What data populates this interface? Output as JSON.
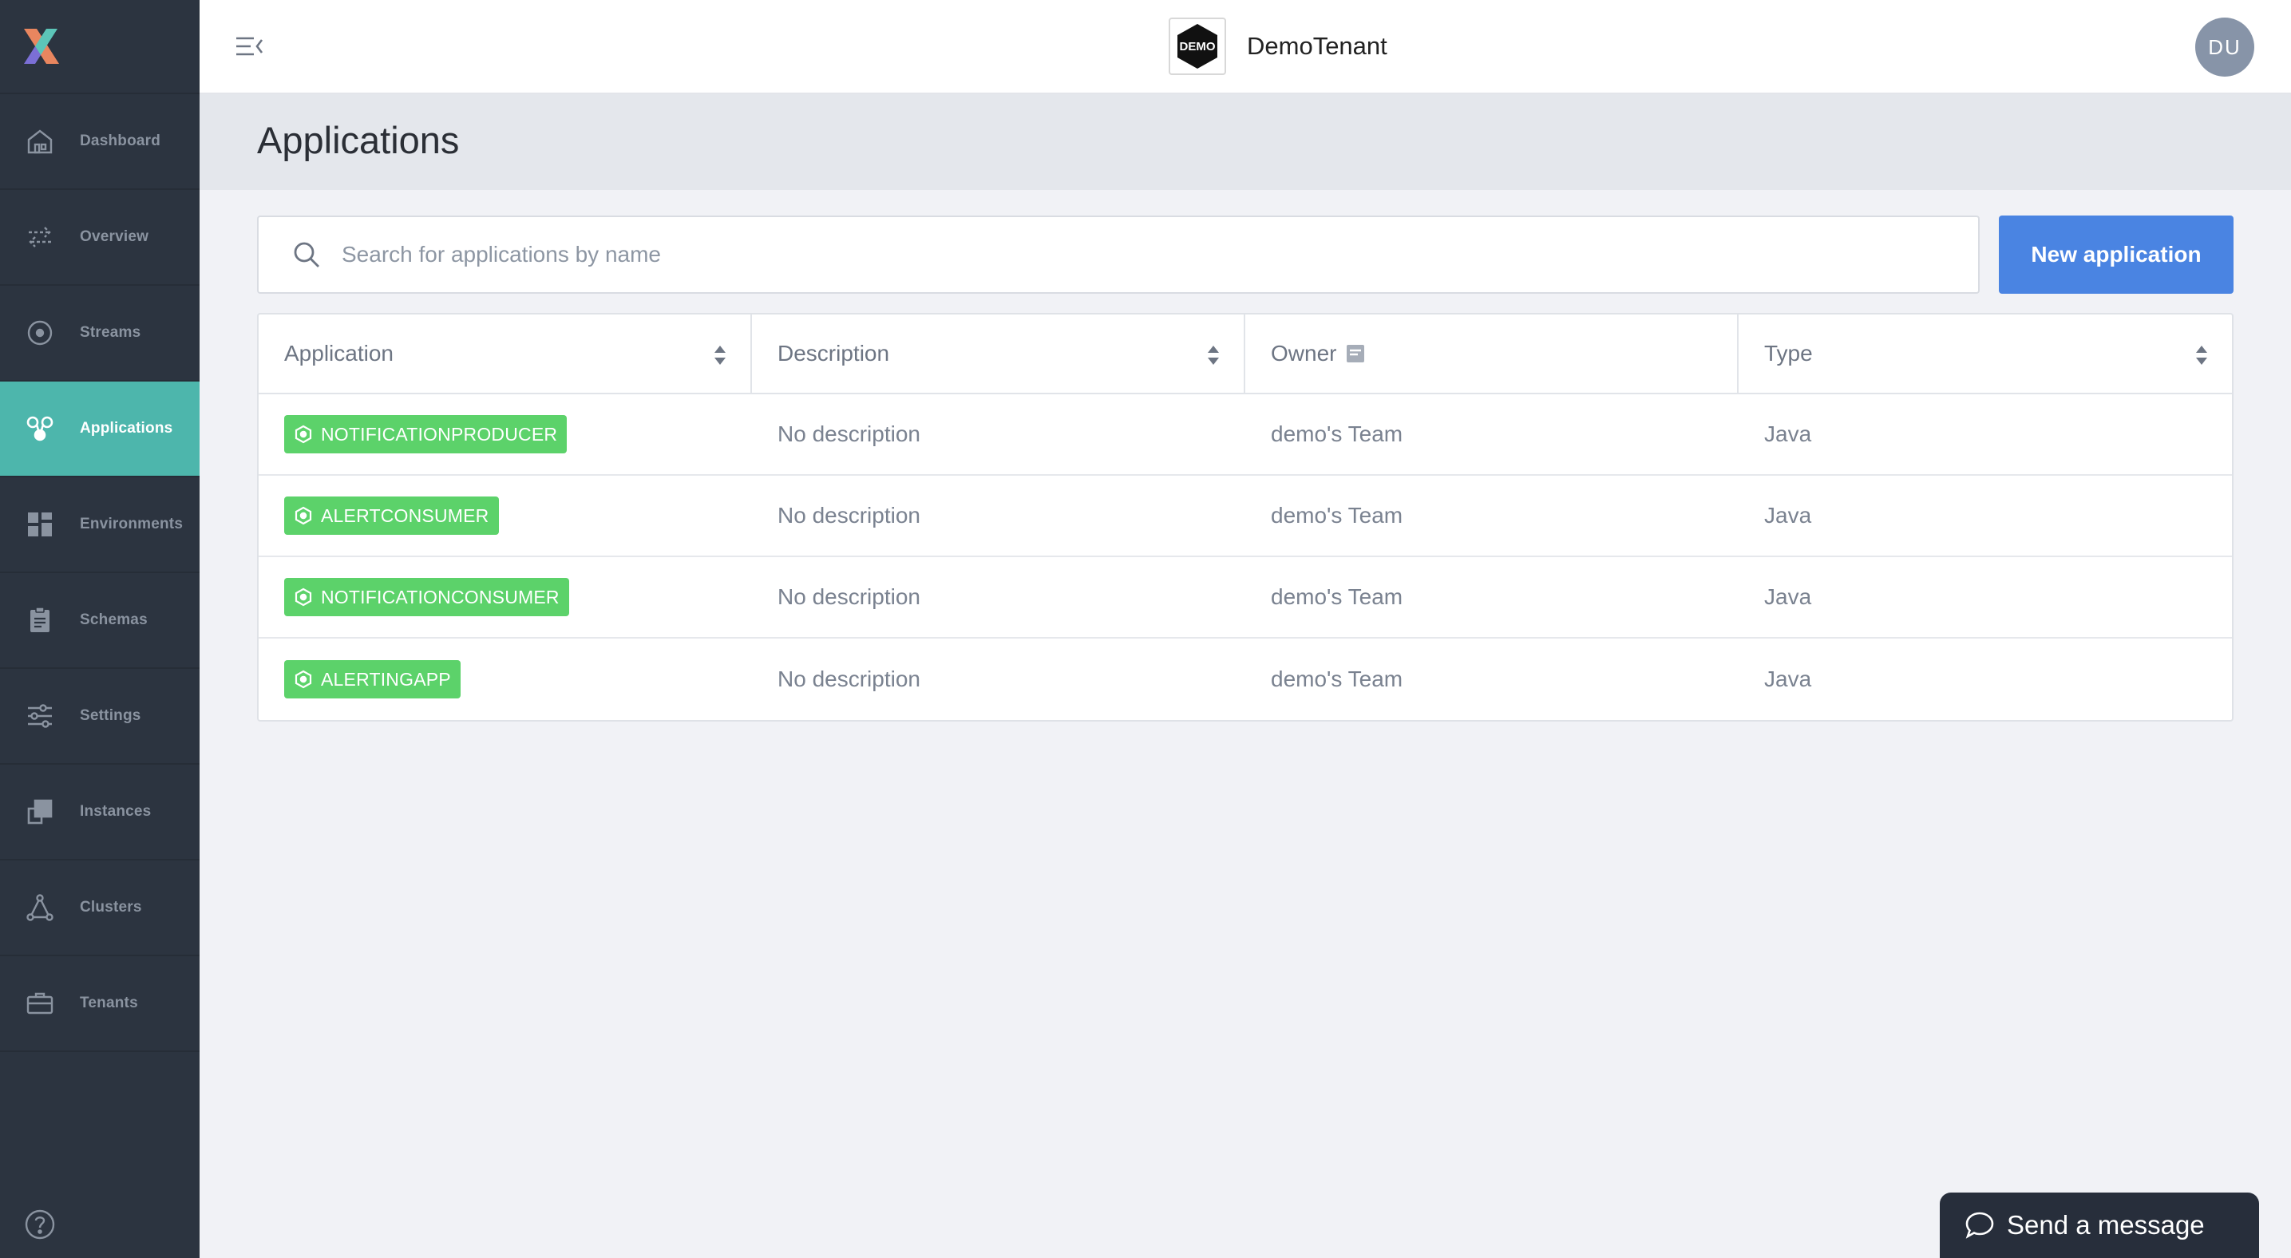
{
  "sidebar": {
    "items": [
      {
        "label": "Dashboard",
        "icon": "home-icon",
        "active": false
      },
      {
        "label": "Overview",
        "icon": "arrows-icon",
        "active": false
      },
      {
        "label": "Streams",
        "icon": "target-icon",
        "active": false
      },
      {
        "label": "Applications",
        "icon": "applications-icon",
        "active": true
      },
      {
        "label": "Environments",
        "icon": "grid-icon",
        "active": false
      },
      {
        "label": "Schemas",
        "icon": "clipboard-icon",
        "active": false
      },
      {
        "label": "Settings",
        "icon": "sliders-icon",
        "active": false
      },
      {
        "label": "Instances",
        "icon": "instances-icon",
        "active": false
      },
      {
        "label": "Clusters",
        "icon": "cluster-icon",
        "active": false
      },
      {
        "label": "Tenants",
        "icon": "briefcase-icon",
        "active": false
      }
    ],
    "help_icon": "question-icon"
  },
  "header": {
    "tenant_logo_text": "DEMO",
    "tenant_name": "DemoTenant",
    "avatar_initials": "DU"
  },
  "page": {
    "title": "Applications"
  },
  "search": {
    "placeholder": "Search for applications by name",
    "value": ""
  },
  "new_button": {
    "label": "New application"
  },
  "table": {
    "columns": [
      {
        "label": "Application",
        "sortable": true
      },
      {
        "label": "Description",
        "sortable": true
      },
      {
        "label": "Owner",
        "sortable": false
      },
      {
        "label": "Type",
        "sortable": true
      }
    ],
    "rows": [
      {
        "application": "NOTIFICATIONPRODUCER",
        "description": "No description",
        "owner": "demo's Team",
        "type": "Java"
      },
      {
        "application": "ALERTCONSUMER",
        "description": "No description",
        "owner": "demo's Team",
        "type": "Java"
      },
      {
        "application": "NOTIFICATIONCONSUMER",
        "description": "No description",
        "owner": "demo's Team",
        "type": "Java"
      },
      {
        "application": "ALERTINGAPP",
        "description": "No description",
        "owner": "demo's Team",
        "type": "Java"
      }
    ]
  },
  "chat": {
    "label": "Send a message"
  },
  "colors": {
    "sidebar_bg": "#2c3440",
    "active_nav": "#4db6ac",
    "primary_button": "#4a84e2",
    "app_badge": "#5cd26a",
    "avatar_bg": "#8794a8"
  }
}
